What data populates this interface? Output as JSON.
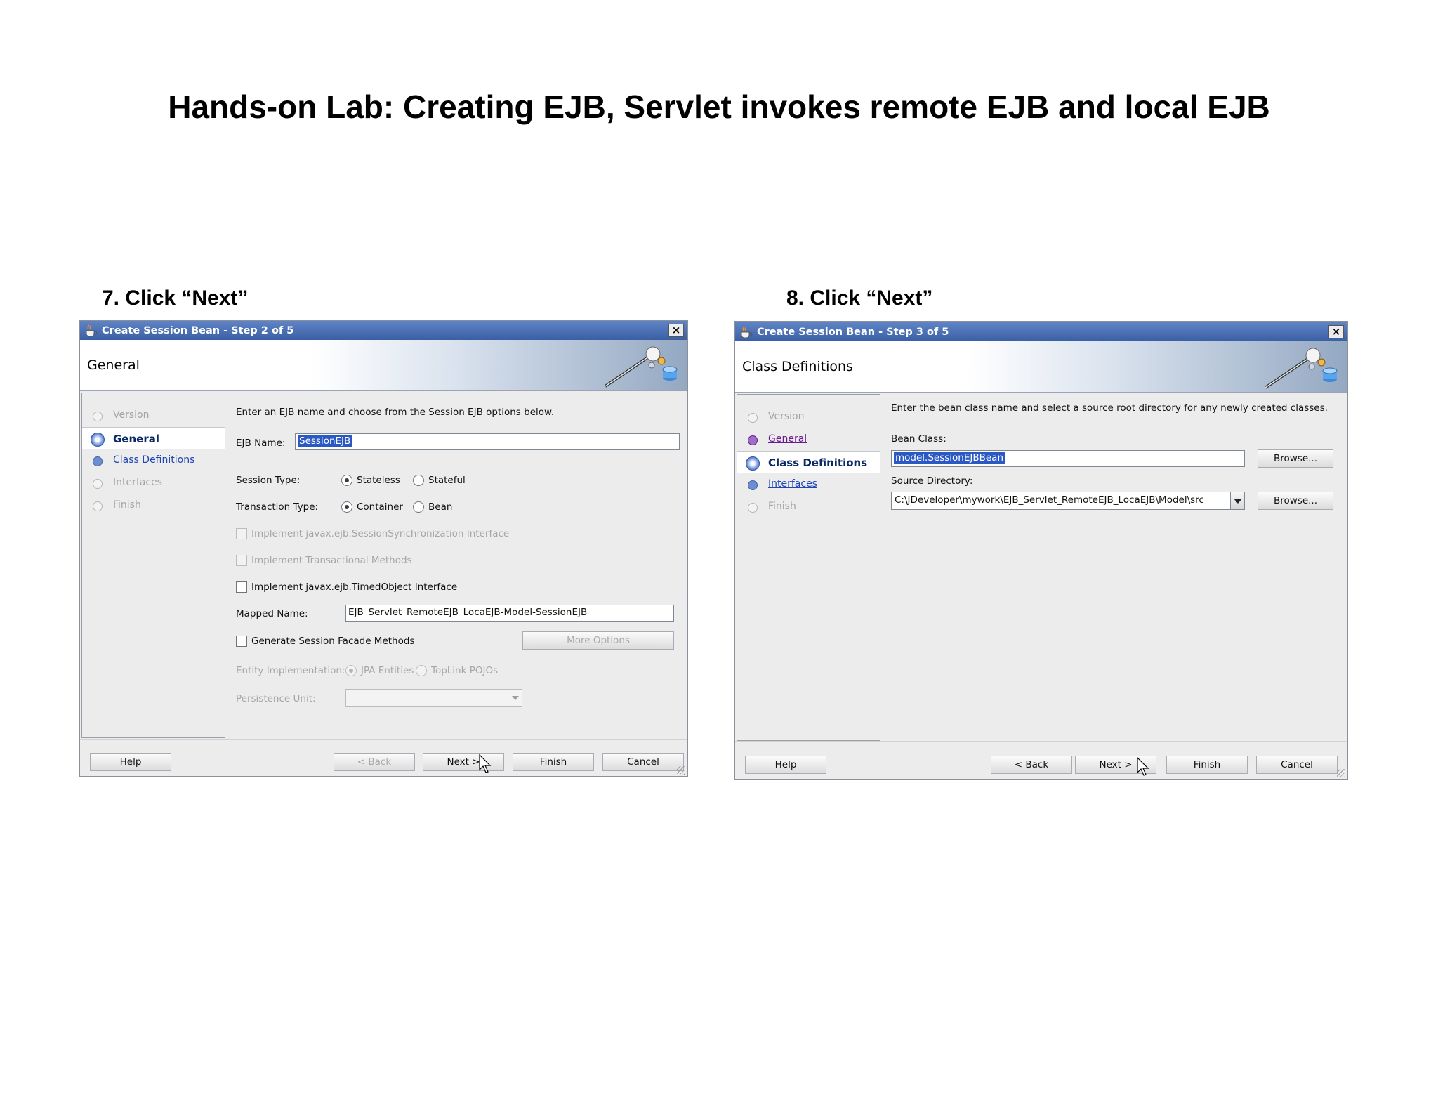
{
  "page": {
    "title": "Hands-on Lab: Creating EJB, Servlet invokes remote EJB and local EJB"
  },
  "step7": {
    "label": "7. Click “Next”",
    "dialog": {
      "window_title": "Create Session Bean - Step 2 of 5",
      "close_glyph": "×",
      "heading": "General",
      "nav": [
        {
          "label": "Version",
          "state": "disabled"
        },
        {
          "label": "General",
          "state": "current"
        },
        {
          "label": "Class Definitions",
          "state": "link"
        },
        {
          "label": "Interfaces",
          "state": "disabled"
        },
        {
          "label": "Finish",
          "state": "disabled"
        }
      ],
      "intro": "Enter an EJB name and choose from the Session EJB options below.",
      "ejb_name_label": "EJB Name:",
      "ejb_name_value": "SessionEJB",
      "session_type_label": "Session Type:",
      "session_type_options": [
        "Stateless",
        "Stateful"
      ],
      "session_type_selected": "Stateless",
      "transaction_type_label": "Transaction Type:",
      "transaction_type_options": [
        "Container",
        "Bean"
      ],
      "transaction_type_selected": "Container",
      "checkbox_session_sync": "Implement javax.ejb.SessionSynchronization Interface",
      "checkbox_transactional": "Implement Transactional Methods",
      "checkbox_timed_object": "Implement javax.ejb.TimedObject Interface",
      "mapped_name_label": "Mapped Name:",
      "mapped_name_value": "EJB_Servlet_RemoteEJB_LocaEJB-Model-SessionEJB",
      "checkbox_facade": "Generate Session Facade Methods",
      "more_options": "More Options",
      "entity_impl_label": "Entity Implementation:",
      "entity_impl_options": [
        "JPA Entities",
        "TopLink POJOs"
      ],
      "persistence_unit_label": "Persistence Unit:",
      "buttons": {
        "help": "Help",
        "back": "< Back",
        "next": "Next >",
        "finish": "Finish",
        "cancel": "Cancel"
      }
    }
  },
  "step8": {
    "label": "8. Click “Next”",
    "dialog": {
      "window_title": "Create Session Bean - Step 3 of 5",
      "close_glyph": "×",
      "heading": "Class Definitions",
      "nav": [
        {
          "label": "Version",
          "state": "disabled"
        },
        {
          "label": "General",
          "state": "visited"
        },
        {
          "label": "Class Definitions",
          "state": "current"
        },
        {
          "label": "Interfaces",
          "state": "link"
        },
        {
          "label": "Finish",
          "state": "disabled"
        }
      ],
      "intro": "Enter the bean class name and select a source root directory for any newly created classes.",
      "bean_class_label": "Bean Class:",
      "bean_class_value": "model.SessionEJBBean",
      "source_dir_label": "Source Directory:",
      "source_dir_value": "C:\\JDeveloper\\mywork\\EJB_Servlet_RemoteEJB_LocaEJB\\Model\\src",
      "browse_label": "Browse...",
      "buttons": {
        "help": "Help",
        "back": "< Back",
        "next": "Next >",
        "finish": "Finish",
        "cancel": "Cancel"
      }
    }
  },
  "colors": {
    "titlebar": "#3a5fa4",
    "selection": "#2b59c3",
    "link": "#2046b5",
    "visited_link": "#6a1b8f"
  },
  "icons": [
    "coffee-cup-icon",
    "close-icon",
    "wizard-banner-art",
    "mouse-cursor-icon",
    "dropdown-arrow-icon"
  ]
}
